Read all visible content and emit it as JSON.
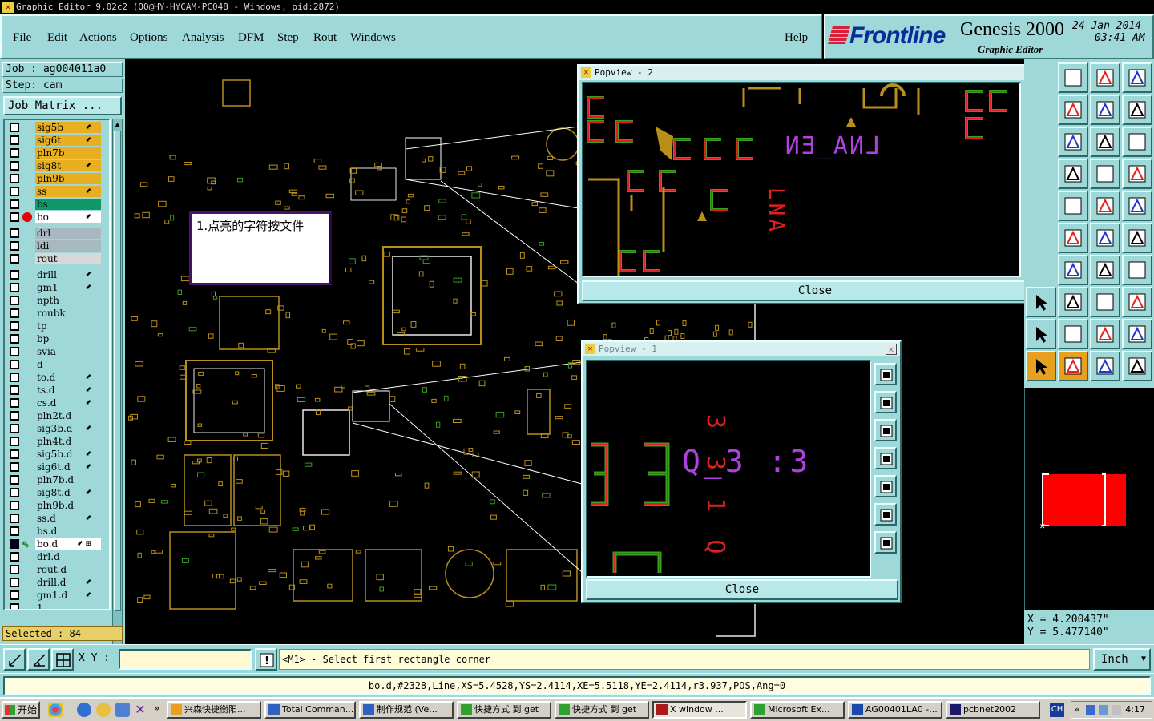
{
  "window": {
    "title": "Graphic Editor 9.02c2 (OO@HY-HYCAM-PC048 - Windows, pid:2872)"
  },
  "menu": {
    "items": [
      "File",
      "Edit",
      "Actions",
      "Options",
      "Analysis",
      "DFM",
      "Step",
      "Rout",
      "Windows"
    ],
    "help": "Help"
  },
  "brand": {
    "logo": "Frontline",
    "product": "Genesis 2000",
    "subtitle": "Graphic Editor",
    "date": "24 Jan 2014",
    "time": "03:41 AM"
  },
  "left": {
    "job": "Job : ag004011a0",
    "step": "Step: cam",
    "job_matrix": "Job Matrix ...",
    "selected": "Selected : 84",
    "layers": [
      {
        "name": "sig5b",
        "color": "#e8b020",
        "flag": "⬋"
      },
      {
        "name": "sig6t",
        "color": "#e8b020",
        "flag": "⬋"
      },
      {
        "name": "pln7b",
        "color": "#e8b020",
        "flag": ""
      },
      {
        "name": "sig8t",
        "color": "#e8b020",
        "flag": "⬋"
      },
      {
        "name": "pln9b",
        "color": "#e8b020",
        "flag": ""
      },
      {
        "name": "ss",
        "color": "#e8b020",
        "flag": "⬋"
      },
      {
        "name": "bs",
        "color": "#109868",
        "flag": ""
      },
      {
        "name": "bo",
        "color": "#ffffff",
        "flag": "⬋",
        "active": true
      },
      {
        "name": "drl",
        "color": "#a8b8c0",
        "flag": ""
      },
      {
        "name": "ldi",
        "color": "#a8b8c0",
        "flag": ""
      },
      {
        "name": "rout",
        "color": "#d8d8d8",
        "flag": ""
      },
      {
        "name": "drill",
        "color": "#9ed8d8",
        "flag": "⬋"
      },
      {
        "name": "gm1",
        "color": "#9ed8d8",
        "flag": "⬋"
      },
      {
        "name": "npth",
        "color": "#9ed8d8",
        "flag": ""
      },
      {
        "name": "roubk",
        "color": "#9ed8d8",
        "flag": ""
      },
      {
        "name": "tp",
        "color": "#9ed8d8",
        "flag": ""
      },
      {
        "name": "bp",
        "color": "#9ed8d8",
        "flag": ""
      },
      {
        "name": "svia",
        "color": "#9ed8d8",
        "flag": ""
      },
      {
        "name": "d",
        "color": "#9ed8d8",
        "flag": ""
      },
      {
        "name": "to.d",
        "color": "#9ed8d8",
        "flag": "⬋"
      },
      {
        "name": "ts.d",
        "color": "#9ed8d8",
        "flag": "⬋"
      },
      {
        "name": "cs.d",
        "color": "#9ed8d8",
        "flag": "⬋"
      },
      {
        "name": "pln2t.d",
        "color": "#9ed8d8",
        "flag": ""
      },
      {
        "name": "sig3b.d",
        "color": "#9ed8d8",
        "flag": "⬋"
      },
      {
        "name": "pln4t.d",
        "color": "#9ed8d8",
        "flag": ""
      },
      {
        "name": "sig5b.d",
        "color": "#9ed8d8",
        "flag": "⬋"
      },
      {
        "name": "sig6t.d",
        "color": "#9ed8d8",
        "flag": "⬋"
      },
      {
        "name": "pln7b.d",
        "color": "#9ed8d8",
        "flag": ""
      },
      {
        "name": "sig8t.d",
        "color": "#9ed8d8",
        "flag": "⬋"
      },
      {
        "name": "pln9b.d",
        "color": "#9ed8d8",
        "flag": ""
      },
      {
        "name": "ss.d",
        "color": "#9ed8d8",
        "flag": "⬋"
      },
      {
        "name": "bs.d",
        "color": "#9ed8d8",
        "flag": ""
      },
      {
        "name": "bo.d",
        "color": "#ffffff",
        "flag": "⬋ ⊞",
        "work": true
      },
      {
        "name": "drl.d",
        "color": "#9ed8d8",
        "flag": ""
      },
      {
        "name": "rout.d",
        "color": "#9ed8d8",
        "flag": ""
      },
      {
        "name": "drill.d",
        "color": "#9ed8d8",
        "flag": "⬋"
      },
      {
        "name": "gm1.d",
        "color": "#9ed8d8",
        "flag": "⬋"
      },
      {
        "name": "1",
        "color": "#9ed8d8",
        "flag": ""
      }
    ]
  },
  "canvas": {
    "note": "1.点亮的字符按文件"
  },
  "popview2": {
    "title": "Popview - 2",
    "close": "Close",
    "text_main": "LNA_EN",
    "text_vert": "LNA"
  },
  "popview1": {
    "title": "Popview - 1",
    "close": "Close",
    "text_main": "Q_3 :3",
    "text_vert": "3 3 1 Q"
  },
  "coords": {
    "x": "X =  4.200437\"",
    "y": "Y =  5.477140\""
  },
  "command": {
    "xy_label": "X Y :",
    "xy_value": "",
    "prompt": "<M1> - Select first rectangle corner",
    "units": "Inch"
  },
  "status": {
    "feature": "bo.d,#2328,Line,XS=5.4528,YS=2.4114,XE=5.5118,YE=2.4114,r3.937,POS,Ang=0"
  },
  "taskbar": {
    "start": "开始",
    "tasks": [
      "兴森快捷衡阳...",
      "Total Comman...",
      "制作规范 (Ve...",
      "快捷方式 到 get",
      "快捷方式 到 get",
      "X window ...",
      "Microsoft Ex...",
      "AG00401LA0 -...",
      "pcbnet2002"
    ],
    "lang": "CH",
    "clock": "4:17"
  },
  "colors": {
    "panel": "#9ed8d8",
    "board_orange": "#c8a020",
    "red": "#e82020",
    "green": "#38c020",
    "purple": "#b040e0"
  }
}
